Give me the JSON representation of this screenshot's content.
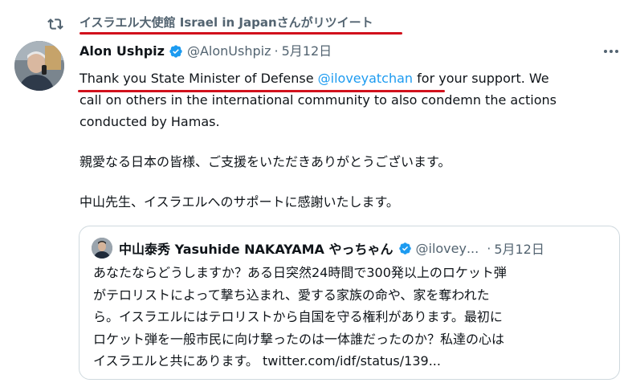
{
  "retweet": {
    "icon": "retweet-icon",
    "text": "イスラエル大使館 Israel in Japanさんがリツイート"
  },
  "tweet": {
    "author_name": "Alon Ushpiz",
    "handle": "@AlonUshpiz",
    "separator": "·",
    "date": "5月12日",
    "more_icon": "more-icon",
    "line1_prefix": "Thank you State Minister of Defense ",
    "line1_mention": "@iloveyatchan",
    "line1_suffix": " for your support. We",
    "line2": "call on others in the international community to also condemn the actions",
    "line3": "conducted by Hamas.",
    "para2": "親愛なる日本の皆様、ご支援をいただきありがとうございます。",
    "para3": "中山先生、イスラエルへのサポートに感謝いたします。"
  },
  "quoted": {
    "author_name": "中山泰秀 Yasuhide NAKAYAMA やっちゃん",
    "handle": "@iloveу...",
    "separator": "·",
    "date": "5月12日",
    "lines": [
      "あなたならどうしますか？ある日突然24時間で300発以上のロケット弾",
      "がテロリストによって撃ち込まれ、愛する家族の命や、家を奪われた",
      "ら。イスラエルにはテロリストから自国を守る権利があります。最初に",
      "ロケット弾を一般市民に向け撃ったのは一体誰だったのか？私達の心は"
    ],
    "last_line_text": "イスラエルと共にあります。 ",
    "last_line_link": "twitter.com/idf/status/139..."
  },
  "colors": {
    "accent": "#1d9bf0",
    "annotation_underline": "#d1111c",
    "secondary_text": "#536471"
  }
}
